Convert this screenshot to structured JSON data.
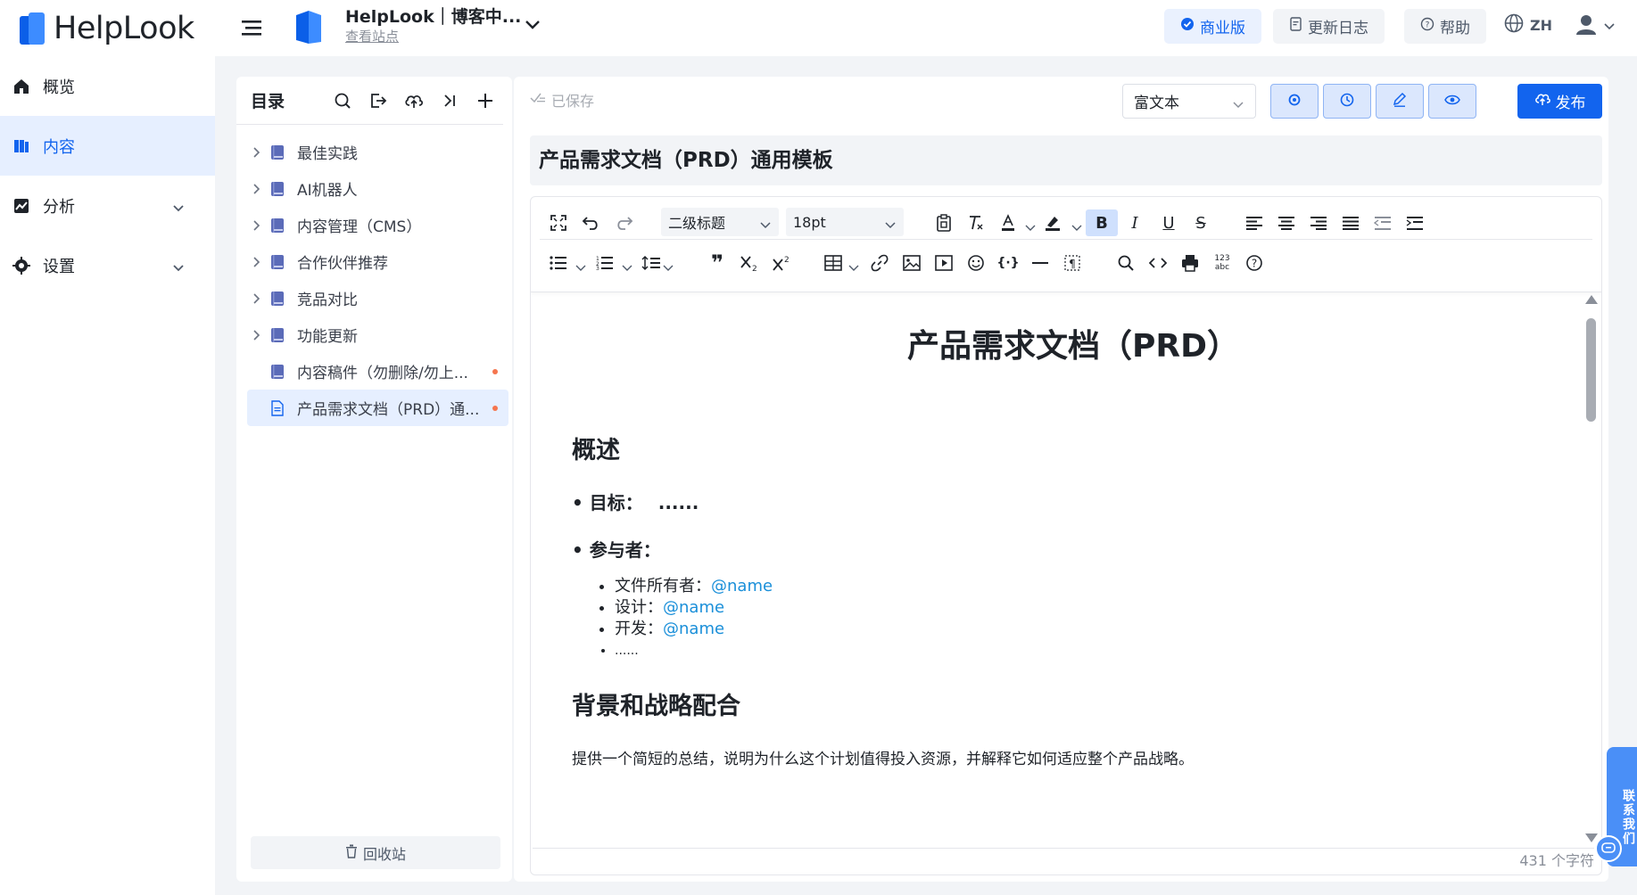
{
  "app": {
    "name": "HelpLook"
  },
  "nav": {
    "items": [
      {
        "label": "概览",
        "icon": "home-icon"
      },
      {
        "label": "内容",
        "icon": "content-icon",
        "active": true
      },
      {
        "label": "分析",
        "icon": "analytics-icon"
      },
      {
        "label": "设置",
        "icon": "gear-icon"
      }
    ]
  },
  "topbar": {
    "site_name": "HelpLook｜博客中...",
    "site_link": "查看站点",
    "pro_label": "商业版",
    "changelog_label": "更新日志",
    "help_label": "帮助",
    "lang_label": "ZH"
  },
  "directory": {
    "title": "目录",
    "items": [
      {
        "label": "最佳实践",
        "type": "book",
        "expandable": true
      },
      {
        "label": "AI机器人",
        "type": "book",
        "expandable": true
      },
      {
        "label": "内容管理（CMS）",
        "type": "book",
        "expandable": true
      },
      {
        "label": "合作伙伴推荐",
        "type": "book",
        "expandable": true
      },
      {
        "label": "竞品对比",
        "type": "book",
        "expandable": true
      },
      {
        "label": "功能更新",
        "type": "book",
        "expandable": true
      },
      {
        "label": "内容稿件（勿删除/勿上...",
        "type": "book",
        "expandable": false,
        "dot": true
      },
      {
        "label": "产品需求文档（PRD）通...",
        "type": "doc",
        "expandable": false,
        "dot": true,
        "active": true
      }
    ],
    "recycle_label": "回收站"
  },
  "editor": {
    "saved_label": "已保存",
    "format_value": "富文本",
    "publish_label": "发布",
    "doc_title": "产品需求文档（PRD）通用模板",
    "heading_select": "二级标题",
    "size_select": "18pt",
    "word_count": "431 个字符"
  },
  "document": {
    "h1": "产品需求文档（PRD）",
    "section1": "概述",
    "goal_label": "• 目标：",
    "goal_value": "......",
    "participants_label": "• 参与者：",
    "people": [
      {
        "role": "文件所有者：",
        "mention": "@name"
      },
      {
        "role": "设计：",
        "mention": "@name"
      },
      {
        "role": "开发：",
        "mention": "@name"
      },
      {
        "role": "......",
        "mention": ""
      }
    ],
    "section2": "背景和战略配合",
    "para": "提供一个简短的总结，说明为什么这个计划值得投入资源，并解释它如何适应整个产品战略。"
  },
  "contact": {
    "label": "联系我们"
  },
  "colors": {
    "accent": "#1264ee",
    "active_bg": "#e6efff",
    "dot": "#f5754e",
    "mention": "#1a8fd9"
  }
}
